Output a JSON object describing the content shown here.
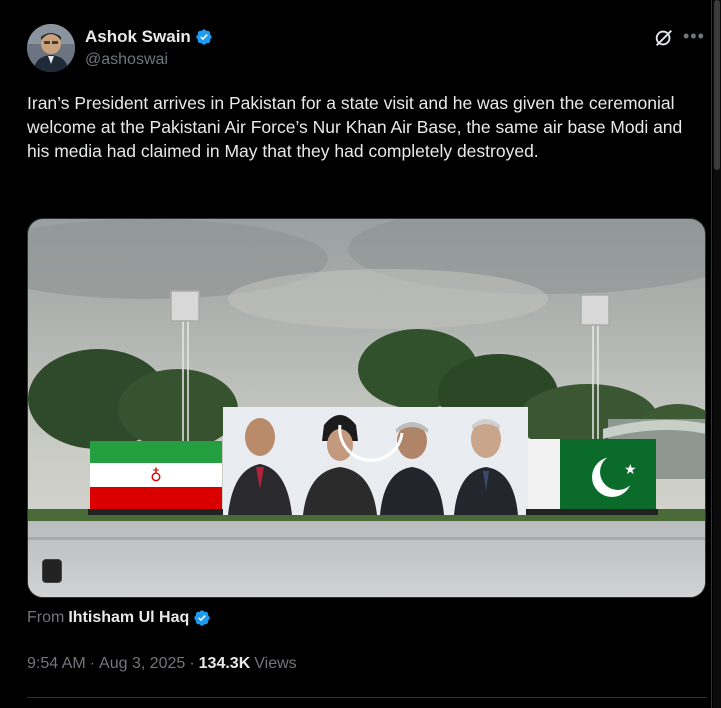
{
  "author": {
    "name": "Ashok Swain",
    "handle": "@ashoswai"
  },
  "tweet": {
    "text": "Iran’s President arrives in Pakistan for a state visit and he was given the ceremonial welcome at the Pakistani Air Force’s Nur Khan Air Base, the same air base Modi and his media had claimed in May that they had completely destroyed."
  },
  "source": {
    "label": "From",
    "name": "Ihtisham Ul Haq"
  },
  "meta": {
    "time": "9:54 AM",
    "date": "Aug 3, 2025",
    "views_count": "134.3K",
    "views_label": "Views"
  },
  "icons": {
    "verified": "verified-badge-icon",
    "grok": "grok-icon",
    "more": "more-icon"
  },
  "colors": {
    "background": "#000000",
    "text": "#e7e9ea",
    "muted": "#71767b",
    "verified": "#1d9bf0",
    "border": "#2f3336"
  }
}
